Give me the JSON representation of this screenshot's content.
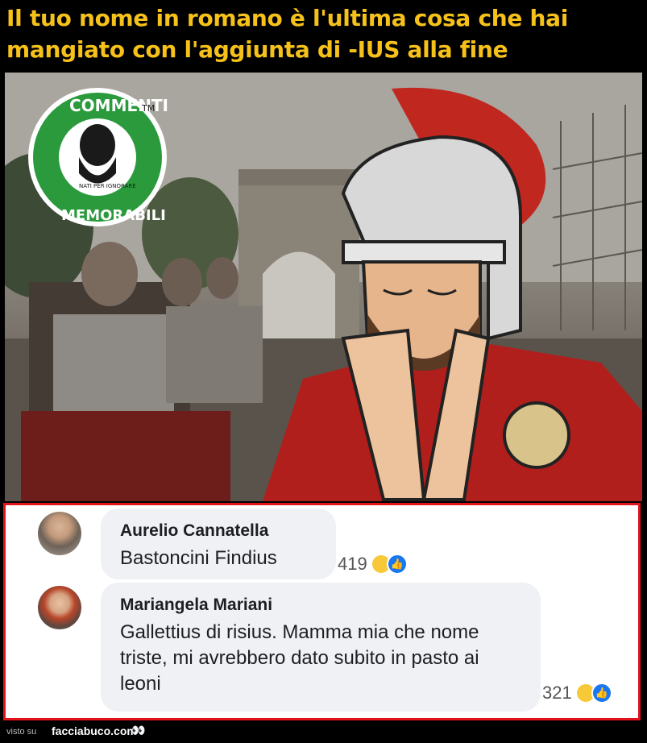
{
  "header": {
    "line1": "Il tuo nome in romano è l'ultima cosa che hai",
    "line2": "mangiato con l'aggiunta di -IUS alla fine"
  },
  "logo": {
    "top_text": "COMMENTI",
    "bottom_text": "MEMORABILI",
    "sub_text": "NATI PER IGNORARE",
    "trademark": "TM",
    "color": "#2a9a3c"
  },
  "comments": [
    {
      "name": "Aurelio Cannatella",
      "text": "Bastoncini Findius",
      "reaction_count": "419"
    },
    {
      "name": "Mariangela Mariani",
      "text": "Gallettius di risius. Mamma mia che nome triste, mi avrebbero dato subito in pasto ai leoni",
      "reaction_count": "321"
    }
  ],
  "footer": {
    "visto_su": "visto su",
    "brand": "facciabuco.com",
    "eyes": "👀"
  },
  "colors": {
    "header_text": "#f6c21a",
    "border": "#e1141c",
    "bubble": "#eff1f4"
  }
}
